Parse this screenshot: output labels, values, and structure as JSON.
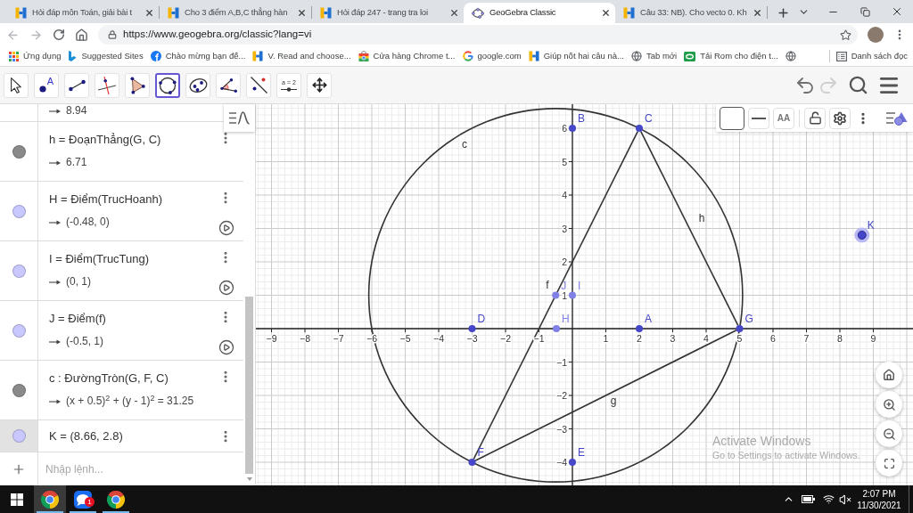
{
  "browser": {
    "tabs": [
      {
        "kind": "h",
        "title": "Hỏi đáp môn Toán, giải bài t",
        "selected": false
      },
      {
        "kind": "h",
        "title": "Cho 3 điểm A,B,C thẳng hàn",
        "selected": false
      },
      {
        "kind": "h",
        "title": "Hỏi đáp 247 - trang tra loi",
        "selected": false
      },
      {
        "kind": "ellipse",
        "title": "GeoGebra Classic",
        "selected": true
      },
      {
        "kind": "h",
        "title": "Câu 33: NB). Cho vecto 0. Kh",
        "selected": false
      }
    ],
    "back": {
      "disabled": true
    },
    "forward": {
      "disabled": true
    },
    "url": "https://www.geogebra.org/classic?lang=vi",
    "bookmarks": [
      {
        "kind": "grid",
        "label": "Ứng dụng"
      },
      {
        "kind": "b",
        "label": "Suggested Sites"
      },
      {
        "kind": "f",
        "label": "Chào mừng bạn đế..."
      },
      {
        "kind": "h",
        "label": "V. Read and choose..."
      },
      {
        "kind": "bag",
        "label": "Cửa hàng Chrome t..."
      },
      {
        "kind": "g",
        "label": "google.com"
      },
      {
        "kind": "h",
        "label": "Giúp nốt hai câu nà..."
      },
      {
        "kind": "globe",
        "label": "Tab mới"
      },
      {
        "kind": "tile",
        "label": "Tải Rom cho điện t..."
      },
      {
        "kind": "globe"
      }
    ],
    "reading_list": "Danh sách đọc"
  },
  "toolbar": {
    "tools": [
      {
        "kind": "move",
        "selected": false
      },
      {
        "kind": "point",
        "caption": "A",
        "selected": false
      },
      {
        "kind": "segment",
        "selected": false
      },
      {
        "kind": "perpendicular",
        "selected": false
      },
      {
        "kind": "polygon",
        "selected": false
      },
      {
        "kind": "circle",
        "selected": true
      },
      {
        "kind": "conic",
        "selected": false
      },
      {
        "kind": "angle",
        "selected": false
      },
      {
        "kind": "reflect",
        "selected": false
      },
      {
        "kind": "slider",
        "caption": "a = 2",
        "selected": false
      },
      {
        "kind": "pan",
        "selected": false
      }
    ],
    "undo": {
      "disabled": false
    },
    "redo": {
      "disabled": true
    }
  },
  "algebra": {
    "rows": [
      {
        "value": "8.94",
        "selected": false
      },
      {
        "definition": "h = ĐoạnThẳng(G, C)",
        "value": "6.71",
        "color": "#8a8a8a",
        "play": false,
        "selected": false
      },
      {
        "definition": "H = Điểm(TrucHoanh)",
        "value": "(-0.48, 0)",
        "color": "#c8c8ff",
        "play": true,
        "selected": false
      },
      {
        "definition": "I = Điểm(TrucTung)",
        "value": "(0, 1)",
        "color": "#c8c8ff",
        "play": true,
        "selected": false
      },
      {
        "definition": "J = Điểm(f)",
        "value": "(-0.5, 1)",
        "color": "#c8c8ff",
        "play": true,
        "selected": false
      },
      {
        "definition": "c : ĐườngTròn(G, F, C)",
        "value": "(x + 0.5)$^{2}$ + (y - 1)$^{2}$ = 31.25",
        "color": "#8a8a8a",
        "play": false,
        "selected": false
      },
      {
        "definition": "K = (8.66, 2.8)",
        "color": "#c8c8ff",
        "play": false,
        "selected": true
      }
    ],
    "input": {
      "placeholder": "Nhập lệnh..."
    }
  },
  "graphics": {
    "style_bar": [
      {
        "kind": "color"
      },
      {
        "kind": "line"
      },
      {
        "kind": "text",
        "caption": "AA"
      },
      {
        "kind": "lock"
      },
      {
        "kind": "settings"
      },
      {
        "kind": "more"
      }
    ],
    "x_ticks": [
      "−9",
      "−8",
      "−7",
      "−6",
      "−5",
      "−4",
      "−3",
      "−2",
      "−1",
      "1",
      "2",
      "3",
      "4",
      "5",
      "6",
      "7",
      "8",
      "9"
    ],
    "y_ticks": [
      "6",
      "5",
      "4",
      "3",
      "2",
      "1",
      "−1",
      "−2",
      "−3",
      "−4"
    ],
    "objects": [
      {
        "kind": "circle",
        "label": "c"
      },
      {
        "kind": "segment",
        "label": "h"
      },
      {
        "kind": "segment",
        "label": "f"
      },
      {
        "kind": "segment",
        "label": "g"
      }
    ],
    "points": [
      {
        "label": "B",
        "color": "#4646c8",
        "selected": false
      },
      {
        "label": "C",
        "color": "#4646c8",
        "selected": false
      },
      {
        "label": "K",
        "color": "#4646c8",
        "selected": true
      },
      {
        "label": "J",
        "color": "#8080e6",
        "selected": false
      },
      {
        "label": "I",
        "color": "#8080e6",
        "selected": false
      },
      {
        "label": "D",
        "color": "#4646c8",
        "selected": false
      },
      {
        "label": "H",
        "color": "#8080e6",
        "selected": false
      },
      {
        "label": "A",
        "color": "#4646c8",
        "selected": false
      },
      {
        "label": "G",
        "color": "#4646c8",
        "selected": false
      },
      {
        "label": "F",
        "color": "#4646c8",
        "selected": false
      },
      {
        "label": "E",
        "color": "#4646c8",
        "selected": false
      }
    ]
  },
  "activation_notice": {
    "title": "Activate Windows",
    "text": "Go to Settings to activate Windows."
  },
  "taskbar": {
    "apps": [
      {
        "kind": "browser",
        "running": true,
        "selected": true
      },
      {
        "kind": "chat",
        "running": true,
        "selected": false,
        "badge": "1"
      },
      {
        "kind": "browser",
        "running": true,
        "selected": false
      }
    ],
    "volume": {
      "muted": true
    },
    "time": "2:07 PM",
    "date": "11/30/2021"
  }
}
